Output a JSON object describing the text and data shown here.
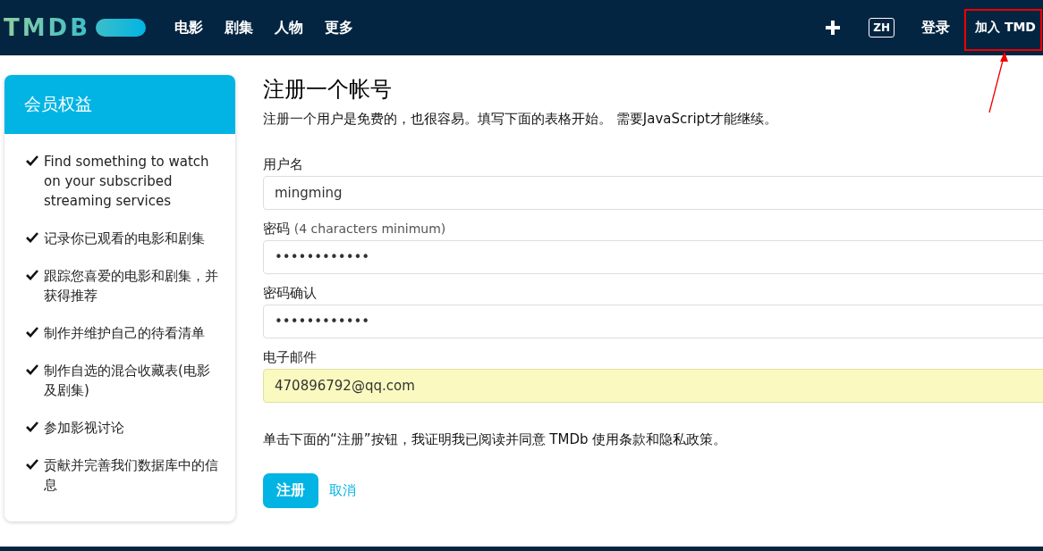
{
  "header": {
    "logo": "TMDB",
    "nav": [
      {
        "label": "电影"
      },
      {
        "label": "剧集"
      },
      {
        "label": "人物"
      },
      {
        "label": "更多"
      }
    ],
    "language": "ZH",
    "login": "登录",
    "join": "加入 TMD"
  },
  "sidebar": {
    "title": "会员权益",
    "items": [
      "Find something to watch on your subscribed streaming services",
      "记录你已观看的电影和剧集",
      "跟踪您喜爱的电影和剧集，并获得推荐",
      "制作并维护自己的待看清单",
      "制作自选的混合收藏表(电影及剧集)",
      "参加影视讨论",
      "贡献并完善我们数据库中的信息"
    ]
  },
  "form": {
    "title": "注册一个帐号",
    "intro": "注册一个用户是免费的，也很容易。填写下面的表格开始。 需要JavaScript才能继续。",
    "fields": [
      {
        "label": "用户名",
        "value": "mingming",
        "autofilled": false
      },
      {
        "label": "密码",
        "hint": "(4 characters minimum)",
        "value": "••••••••••••",
        "autofilled": false
      },
      {
        "label": "密码确认",
        "value": "••••••••••••",
        "autofilled": false
      },
      {
        "label": "电子邮件",
        "value": "470896792@qq.com",
        "autofilled": true
      }
    ],
    "terms": "单击下面的“注册”按钮，我证明我已阅读并同意 TMDb 使用条款和隐私政策。",
    "submit": "注册",
    "cancel": "取消"
  }
}
